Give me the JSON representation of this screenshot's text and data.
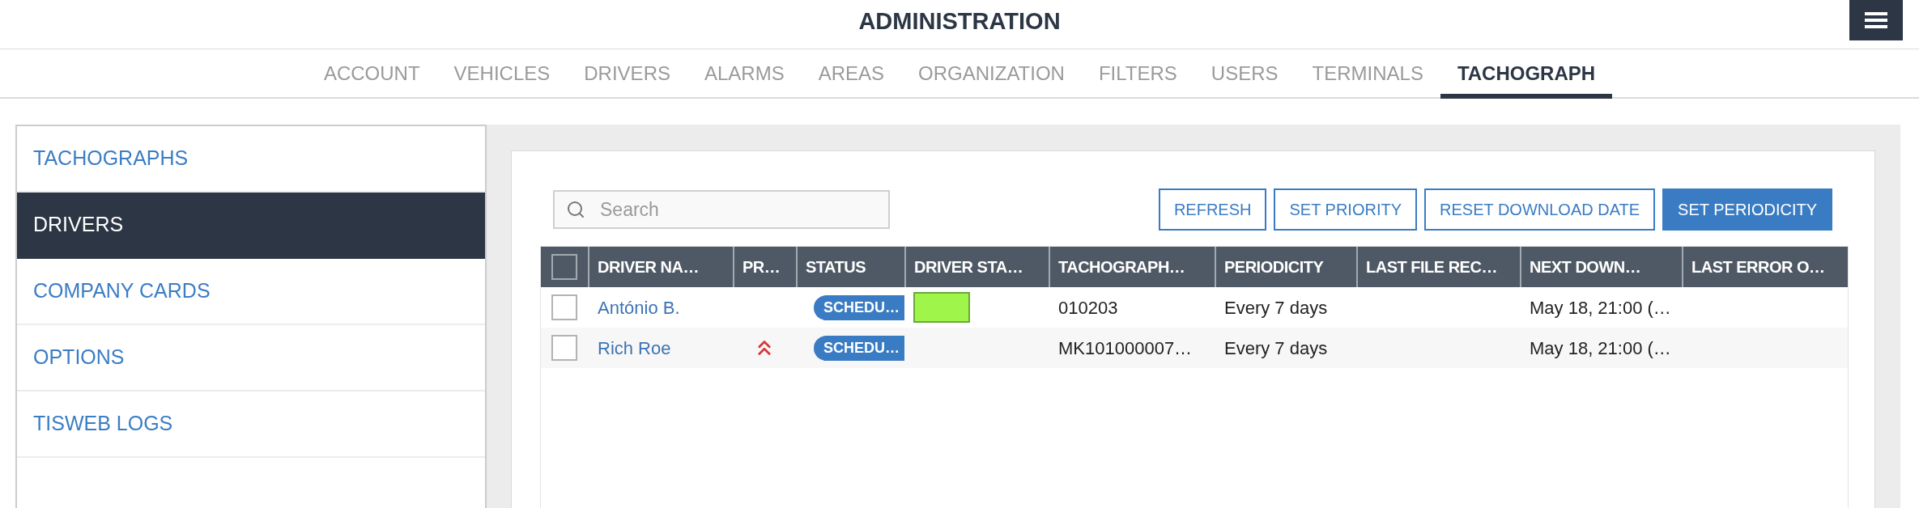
{
  "header": {
    "title": "ADMINISTRATION"
  },
  "tabs": [
    {
      "label": "ACCOUNT",
      "selected": false
    },
    {
      "label": "VEHICLES",
      "selected": false
    },
    {
      "label": "DRIVERS",
      "selected": false
    },
    {
      "label": "ALARMS",
      "selected": false
    },
    {
      "label": "AREAS",
      "selected": false
    },
    {
      "label": "ORGANIZATION",
      "selected": false
    },
    {
      "label": "FILTERS",
      "selected": false
    },
    {
      "label": "USERS",
      "selected": false
    },
    {
      "label": "TERMINALS",
      "selected": false
    },
    {
      "label": "TACHOGRAPH",
      "selected": true
    }
  ],
  "sidebar": {
    "items": [
      {
        "label": "TACHOGRAPHS",
        "selected": false
      },
      {
        "label": "DRIVERS",
        "selected": true
      },
      {
        "label": "COMPANY CARDS",
        "selected": false
      },
      {
        "label": "OPTIONS",
        "selected": false
      },
      {
        "label": "TISWEB LOGS",
        "selected": false
      }
    ]
  },
  "toolbar": {
    "search": {
      "placeholder": "Search"
    },
    "buttons": [
      {
        "label": "REFRESH",
        "primary": false
      },
      {
        "label": "SET PRIORITY",
        "primary": false
      },
      {
        "label": "RESET DOWNLOAD DATE",
        "primary": false
      },
      {
        "label": "SET PERIODICITY",
        "primary": true
      }
    ]
  },
  "table": {
    "select_all": {
      "checked": false
    },
    "columns": [
      "DRIVER NA…",
      "PR…",
      "STATUS",
      "DRIVER STA…",
      "TACHOGRAPH…",
      "PERIODICITY",
      "LAST FILE REC…",
      "NEXT DOWN…",
      "LAST ERROR O…"
    ],
    "rows": [
      {
        "checked": false,
        "driver_name": "António B.",
        "high_priority": false,
        "status": "SCHEDU…",
        "driver_status": {
          "color": "#a0f54b"
        },
        "tachograph": "010203",
        "periodicity": "Every 7 days",
        "next_download": "May 18, 21:00 (…"
      },
      {
        "checked": false,
        "driver_name": "Rich Roe",
        "high_priority": true,
        "status": "SCHEDU…",
        "tachograph": "MK101000007…",
        "periodicity": "Every 7 days",
        "next_download": "May 18, 21:00 (…"
      }
    ]
  }
}
